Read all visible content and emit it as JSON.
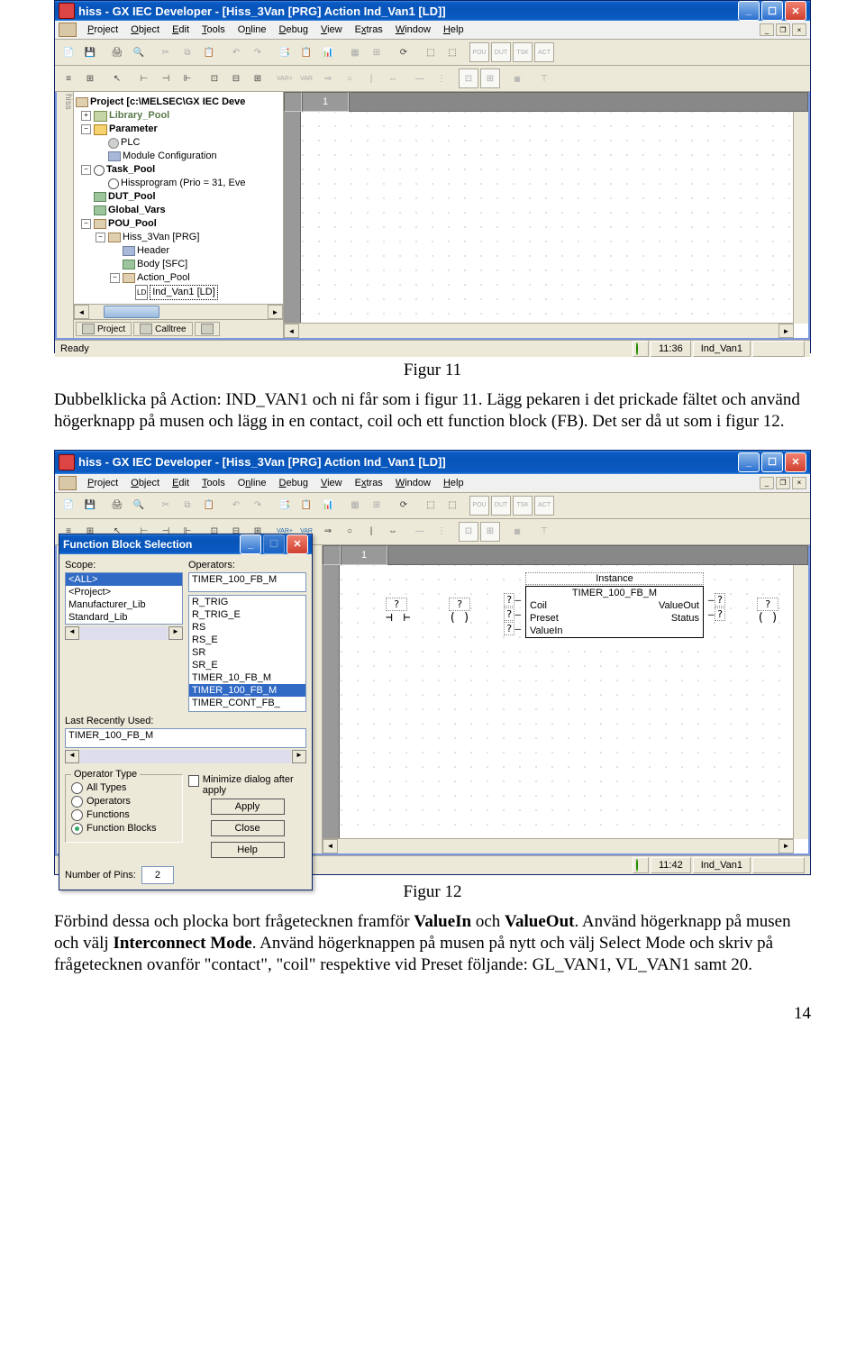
{
  "screenshot1": {
    "title": "hiss - GX IEC Developer - [Hiss_3Van [PRG] Action Ind_Van1 [LD]]",
    "menus": {
      "project": "Project",
      "object": "Object",
      "edit": "Edit",
      "tools": "Tools",
      "online": "Online",
      "debug": "Debug",
      "view": "View",
      "extras": "Extras",
      "window": "Window",
      "help": "Help"
    },
    "leftbar": "hiss",
    "tree": {
      "root": "Project [c:\\MELSEC\\GX IEC Deve",
      "library": "Library_Pool",
      "parameter": "Parameter",
      "plc": "PLC",
      "module": "Module Configuration",
      "taskpool": "Task_Pool",
      "hissprogram": "Hissprogram (Prio = 31, Eve",
      "dutpool": "DUT_Pool",
      "globalvars": "Global_Vars",
      "poupool": "POU_Pool",
      "hiss3van": "Hiss_3Van [PRG]",
      "header": "Header",
      "body": "Body [SFC]",
      "actionpool": "Action_Pool",
      "indvan": "Ind_Van1 [LD]"
    },
    "tabs": {
      "project": "Project",
      "calltree": "Calltree"
    },
    "editor_cell": "1",
    "status_ready": "Ready",
    "status_time": "11:36",
    "status_file": "Ind_Van1"
  },
  "caption1": "Figur 11",
  "para1": "Dubbelklicka på Action: IND_VAN1 och ni får som i figur 11. Lägg pekaren i det prickade fältet och använd högerknapp på musen och lägg in en contact, coil och ett function block (FB). Det ser då ut som i figur 12.",
  "screenshot2": {
    "title": "hiss - GX IEC Developer - [Hiss_3Van [PRG] Action Ind_Van1 [LD]]",
    "dlg": {
      "title": "Function Block Selection",
      "scope_label": "Scope:",
      "operators_label": "Operators:",
      "scope_list": [
        "<ALL>",
        "<Project>",
        "Manufacturer_Lib",
        "Standard_Lib"
      ],
      "ops_list": [
        "TIMER_100_FB_M",
        "",
        "R_TRIG",
        "R_TRIG_E",
        "RS",
        "RS_E",
        "SR",
        "SR_E",
        "TIMER_10_FB_M",
        "TIMER_100_FB_M",
        "TIMER_CONT_FB_"
      ],
      "lru_label": "Last Recently Used:",
      "lru": "TIMER_100_FB_M",
      "group_label": "Operator Type",
      "r_all": "All Types",
      "r_ops": "Operators",
      "r_fn": "Functions",
      "r_fb": "Function Blocks",
      "min_label": "Minimize dialog after apply",
      "apply": "Apply",
      "close": "Close",
      "help": "Help",
      "pins_label": "Number of Pins:",
      "pins": "2"
    },
    "editor_cell": "1",
    "instance": {
      "title": "Instance",
      "name": "TIMER_100_FB_M",
      "coil": "Coil",
      "preset": "Preset",
      "valuein": "ValueIn",
      "valueout": "ValueOut",
      "status": "Status",
      "q": "?"
    },
    "status_time": "11:42",
    "status_file": "Ind_Van1"
  },
  "caption2": "Figur 12",
  "para2_a": "Förbind dessa och plocka bort frågetecknen framför ",
  "para2_b": " och ",
  "para2_c": ". Använd högerknapp på musen och välj ",
  "para2_d": ". Använd högerknappen på musen på nytt och välj Select Mode och skriv på frågetecknen ovanför \"contact\", \"coil\" respektive vid Preset följande: GL_VAN1, VL_VAN1 samt 20.",
  "bold_valuein": "ValueIn",
  "bold_valueout": "ValueOut",
  "bold_interconnect": "Interconnect Mode",
  "pagenum": "14"
}
